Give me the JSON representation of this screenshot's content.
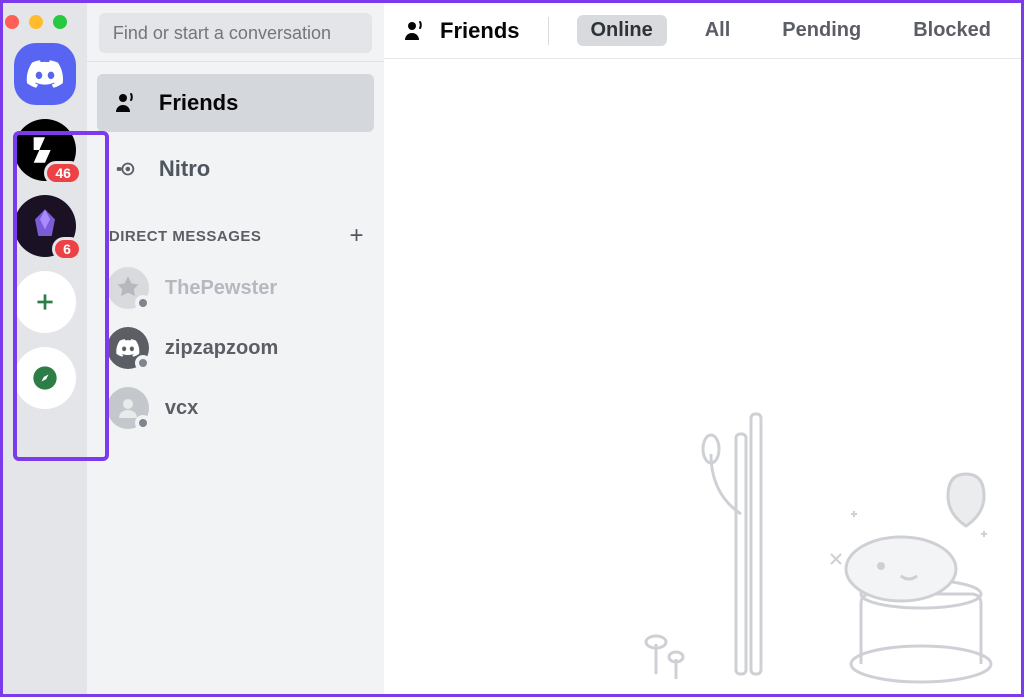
{
  "search": {
    "placeholder": "Find or start a conversation"
  },
  "server_rail": {
    "badge1": "46",
    "badge2": "6"
  },
  "sidebar": {
    "friends_label": "Friends",
    "nitro_label": "Nitro",
    "dm_header": "DIRECT MESSAGES",
    "dms": [
      {
        "name": "ThePewster"
      },
      {
        "name": "zipzapzoom"
      },
      {
        "name": "vcx"
      }
    ]
  },
  "topbar": {
    "title": "Friends",
    "tabs": {
      "online": "Online",
      "all": "All",
      "pending": "Pending",
      "blocked": "Blocked"
    }
  }
}
